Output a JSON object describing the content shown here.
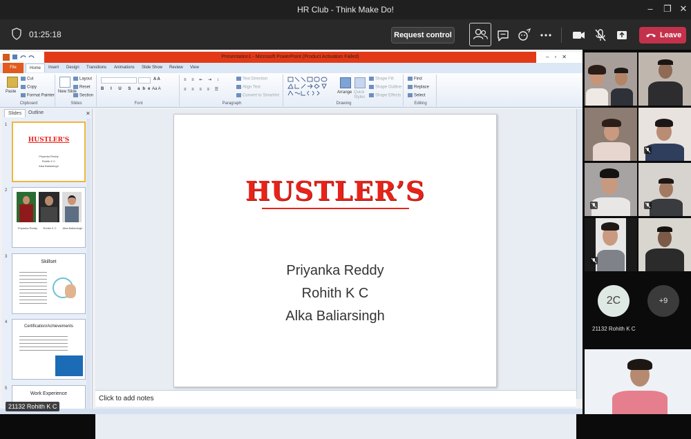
{
  "window": {
    "title": "HR Club - Think Make Do!",
    "controls": [
      "–",
      "❐",
      "✕"
    ]
  },
  "toolbar": {
    "timer": "01:25:18",
    "request_control_label": "Request control",
    "leave_label": "Leave",
    "icons": [
      "people-icon",
      "chat-icon",
      "reactions-icon",
      "more-icon",
      "camera-icon",
      "mic-off-icon",
      "share-icon",
      "phone-hangup-icon"
    ]
  },
  "powerpoint": {
    "window_title": "Presentation1 - Microsoft PowerPoint (Product Activation Failed)",
    "tabs": [
      "File",
      "Home",
      "Insert",
      "Design",
      "Transitions",
      "Animations",
      "Slide Show",
      "Review",
      "View"
    ],
    "ribbon": {
      "clipboard": {
        "paste": "Paste",
        "cut": "Cut",
        "copy": "Copy",
        "format_painter": "Format Painter",
        "label": "Clipboard"
      },
      "slides": {
        "new_slide": "New Slide",
        "layout": "Layout",
        "reset": "Reset",
        "section": "Section",
        "label": "Slides"
      },
      "font": {
        "label": "Font"
      },
      "paragraph": {
        "text_direction": "Text Direction",
        "align_text": "Align Text",
        "convert": "Convert to SmartArt",
        "label": "Paragraph"
      },
      "drawing": {
        "arrange": "Arrange",
        "quick_styles": "Quick Styles",
        "shape_fill": "Shape Fill",
        "shape_outline": "Shape Outline",
        "shape_effects": "Shape Effects",
        "label": "Drawing"
      },
      "editing": {
        "find": "Find",
        "replace": "Replace",
        "select": "Select",
        "label": "Editing"
      }
    },
    "pane_tabs": {
      "slides": "Slides",
      "outline": "Outline"
    },
    "thumbnails": [
      {
        "num": "1",
        "title": "HUSTLER'S",
        "lines": [
          "Priyanka Reddy",
          "Rohith K C",
          "Alka Baliarsingh"
        ]
      },
      {
        "num": "2",
        "captions": [
          "Priyanka Reddy",
          "Rohith K C",
          "Alka Baliarsingh"
        ]
      },
      {
        "num": "3",
        "title": "Skillset"
      },
      {
        "num": "4",
        "title": "Certification/Achievements"
      },
      {
        "num": "5",
        "title": "Work Experience"
      }
    ],
    "slide": {
      "title": "HUSTLER’S",
      "names": [
        "Priyanka Reddy",
        "Rohith K C",
        "Alka Baliarsingh"
      ]
    },
    "notes_placeholder": "Click to add notes"
  },
  "presenter_tag": "21132 Rohith K C",
  "gallery": {
    "avatar_initials": "2C",
    "avatar_name": "21132 Rohith K C",
    "overflow_count": "+9"
  },
  "colors": {
    "teams_bg": "#292929",
    "leave_red": "#c4314b",
    "ppt_red_bar": "#e23a18",
    "hustler_red": "#e8231a"
  }
}
